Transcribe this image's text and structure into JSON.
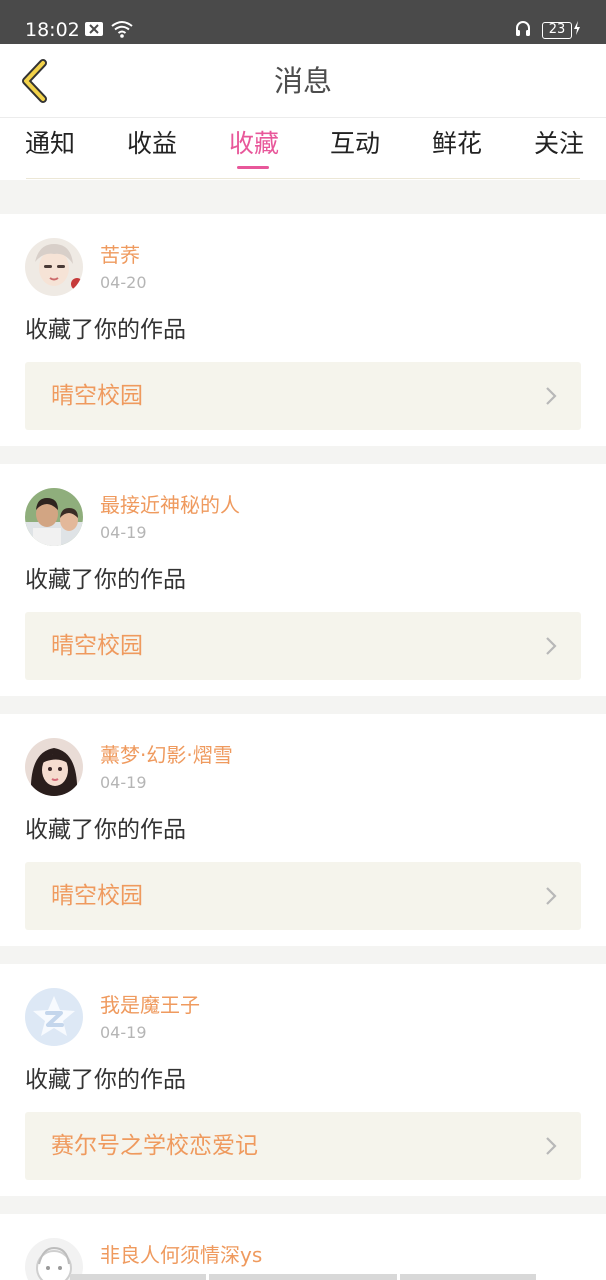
{
  "status_bar": {
    "time": "18:02",
    "battery_level": "23",
    "icons": [
      "notification-x-icon",
      "wifi-icon",
      "headset-icon",
      "battery-icon",
      "charging-icon"
    ]
  },
  "header": {
    "title": "消息",
    "back_icon": "chevron-left-icon"
  },
  "tabs": [
    {
      "label": "通知",
      "active": false
    },
    {
      "label": "收益",
      "active": false
    },
    {
      "label": "收藏",
      "active": true
    },
    {
      "label": "互动",
      "active": false
    },
    {
      "label": "鲜花",
      "active": false
    },
    {
      "label": "关注",
      "active": false
    }
  ],
  "colors": {
    "accent_pink": "#e8579a",
    "name_orange": "#ef9a5e",
    "status_bar_bg": "#4a4a4a"
  },
  "messages": [
    {
      "username": "苦荞",
      "date": "04-20",
      "action": "收藏了你的作品",
      "work_title": "晴空校园"
    },
    {
      "username": "最接近神秘的人",
      "date": "04-19",
      "action": "收藏了你的作品",
      "work_title": "晴空校园"
    },
    {
      "username": "薰梦·幻影·熠雪",
      "date": "04-19",
      "action": "收藏了你的作品",
      "work_title": "晴空校园"
    },
    {
      "username": "我是魔王子",
      "date": "04-19",
      "action": "收藏了你的作品",
      "work_title": "赛尔号之学校恋爱记"
    },
    {
      "username": "非良人何须情深ys",
      "date": "",
      "action": "",
      "work_title": ""
    }
  ]
}
